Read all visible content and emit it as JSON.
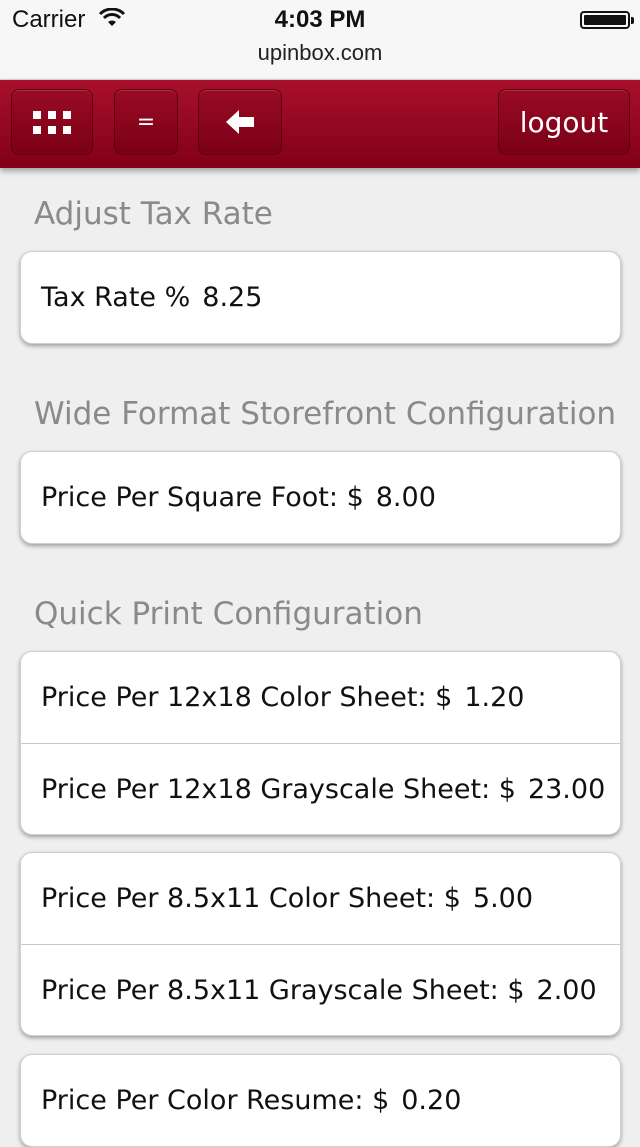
{
  "status_bar": {
    "carrier": "Carrier",
    "time": "4:03 PM",
    "url": "upinbox.com"
  },
  "toolbar": {
    "grid_icon": "grid-icon",
    "equals_label": "=",
    "back_icon": "arrow-left-icon",
    "logout_label": "logout",
    "color": "#8e0520"
  },
  "sections": {
    "tax": {
      "title": "Adjust Tax Rate",
      "rows": [
        {
          "label": "Tax Rate %",
          "value": "8.25"
        }
      ]
    },
    "wide_format": {
      "title": "Wide Format Storefront Configuration",
      "rows": [
        {
          "label": "Price Per Square Foot: $",
          "value": "8.00"
        }
      ]
    },
    "quick_print": {
      "title": "Quick Print Configuration",
      "group1": [
        {
          "label": "Price Per 12x18 Color Sheet: $",
          "value": "1.20"
        },
        {
          "label": "Price Per 12x18 Grayscale Sheet: $",
          "value": "23.00"
        }
      ],
      "group2": [
        {
          "label": "Price Per 8.5x11 Color Sheet: $",
          "value": "5.00"
        },
        {
          "label": "Price Per 8.5x11 Grayscale Sheet: $",
          "value": "2.00"
        }
      ],
      "group3": [
        {
          "label": "Price Per Color Resume: $",
          "value": "0.20"
        }
      ]
    }
  }
}
